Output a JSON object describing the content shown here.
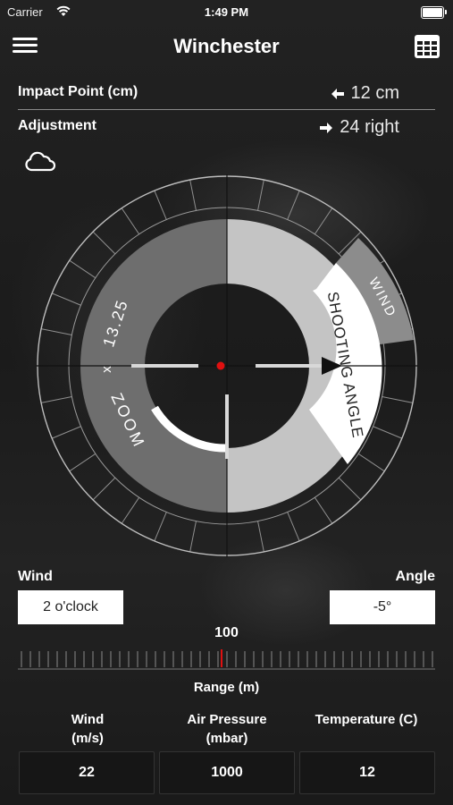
{
  "status": {
    "carrier": "Carrier",
    "time": "1:49 PM"
  },
  "nav": {
    "title": "Winchester",
    "menu_icon": "hamburger-menu-icon",
    "grid_icon": "grid-table-icon"
  },
  "impact": {
    "label": "Impact Point (cm)",
    "value": "12 cm",
    "arrow": "left"
  },
  "adjustment": {
    "label": "Adjustment",
    "value": "24 right",
    "arrow": "right"
  },
  "weather_icon": "cloud-icon",
  "scope": {
    "zoom_label": "ZOOM",
    "zoom_value": "13.25",
    "zoom_prefix": "x",
    "shooting_angle_label": "SHOOTING ANGLE",
    "wind_label": "WIND",
    "colors": {
      "dark_sector": "#6e6e6e",
      "light_sector": "#c4c4c4",
      "white_band": "#ffffff",
      "dot": "#e01010"
    }
  },
  "wind": {
    "label": "Wind",
    "value": "2 o'clock"
  },
  "angle": {
    "label": "Angle",
    "value": "-5°"
  },
  "range": {
    "value": "100",
    "label": "Range (m)"
  },
  "table": {
    "headers": [
      "Wind\n(m/s)",
      "Air Pressure\n(mbar)",
      "Temperature (C)"
    ],
    "values": [
      "22",
      "1000",
      "12"
    ]
  }
}
